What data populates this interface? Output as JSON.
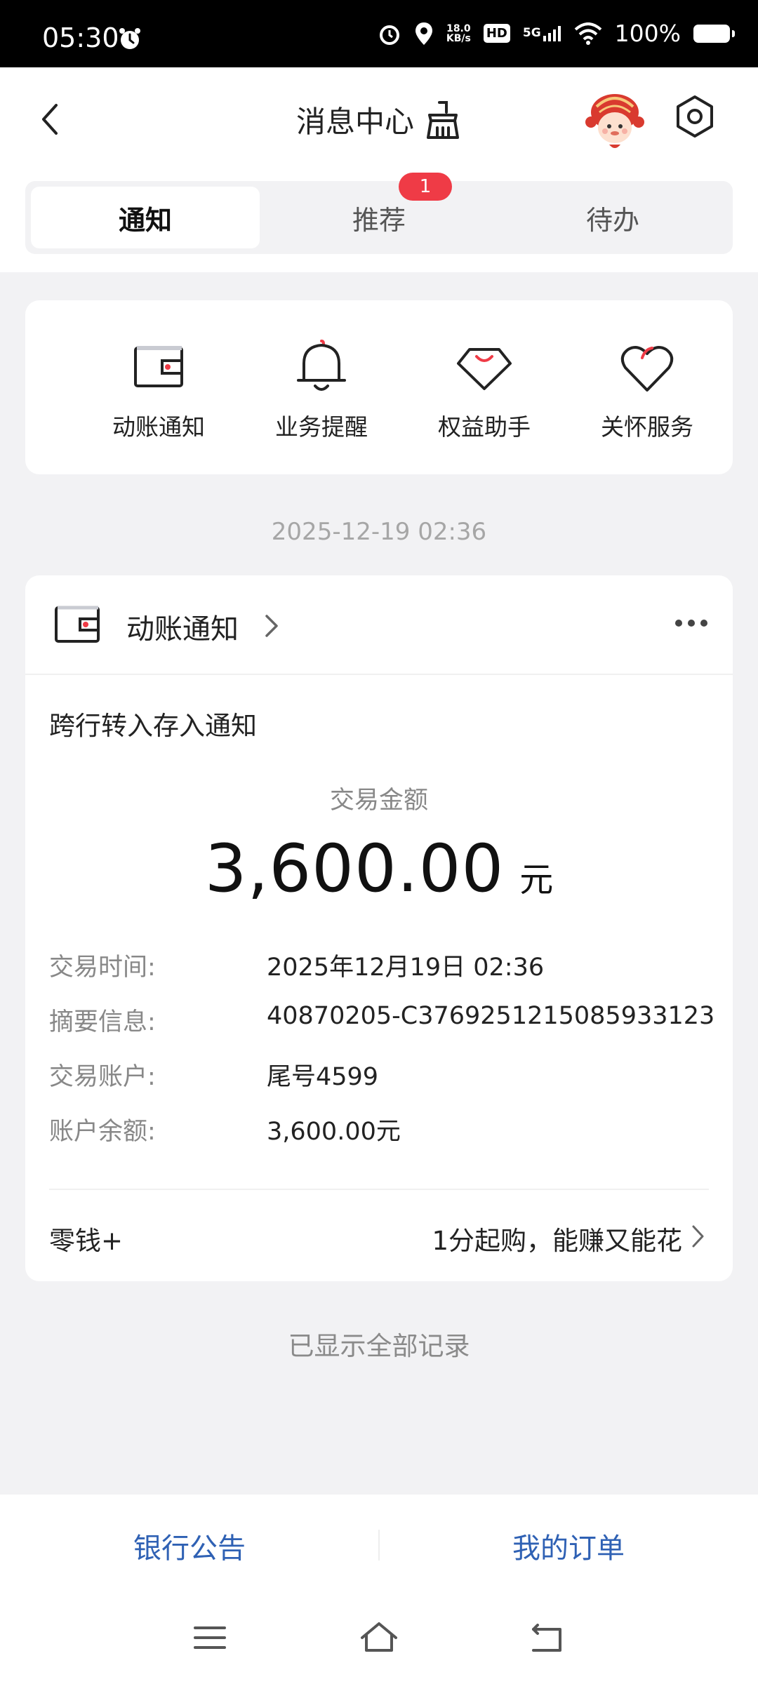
{
  "status_bar": {
    "time": "05:30",
    "net_speed_value": "18.0",
    "net_speed_unit": "KB/s",
    "hd_badge": "HD",
    "network": "5G",
    "battery": "100%"
  },
  "header": {
    "title": "消息中心",
    "tabs": [
      {
        "label": "通知",
        "active": true
      },
      {
        "label": "推荐",
        "badge": "1"
      },
      {
        "label": "待办"
      }
    ]
  },
  "categories": [
    {
      "label": "动账通知",
      "icon": "wallet-icon"
    },
    {
      "label": "业务提醒",
      "icon": "bell-icon"
    },
    {
      "label": "权益助手",
      "icon": "diamond-icon"
    },
    {
      "label": "关怀服务",
      "icon": "heart-icon"
    }
  ],
  "message_time": "2025-12-19 02:36",
  "notification": {
    "category": "动账通知",
    "subject": "跨行转入存入通知",
    "amount_label": "交易金额",
    "amount": "3,600.00",
    "amount_unit": "元",
    "details": [
      {
        "label": "交易时间:",
        "value": "2025年12月19日 02:36"
      },
      {
        "label": "摘要信息:",
        "value": "40870205-C3769251215085933123"
      },
      {
        "label": "交易账户:",
        "value": "尾号4599"
      },
      {
        "label": "账户余额:",
        "value": "3,600.00元"
      }
    ],
    "promo_label": "零钱+",
    "promo_text": "1分起购，能赚又能花"
  },
  "footer_note": "已显示全部记录",
  "bottom_links": {
    "left": "银行公告",
    "right": "我的订单"
  },
  "colors": {
    "accent_red": "#ef3b46",
    "link_blue": "#2f61b4"
  }
}
